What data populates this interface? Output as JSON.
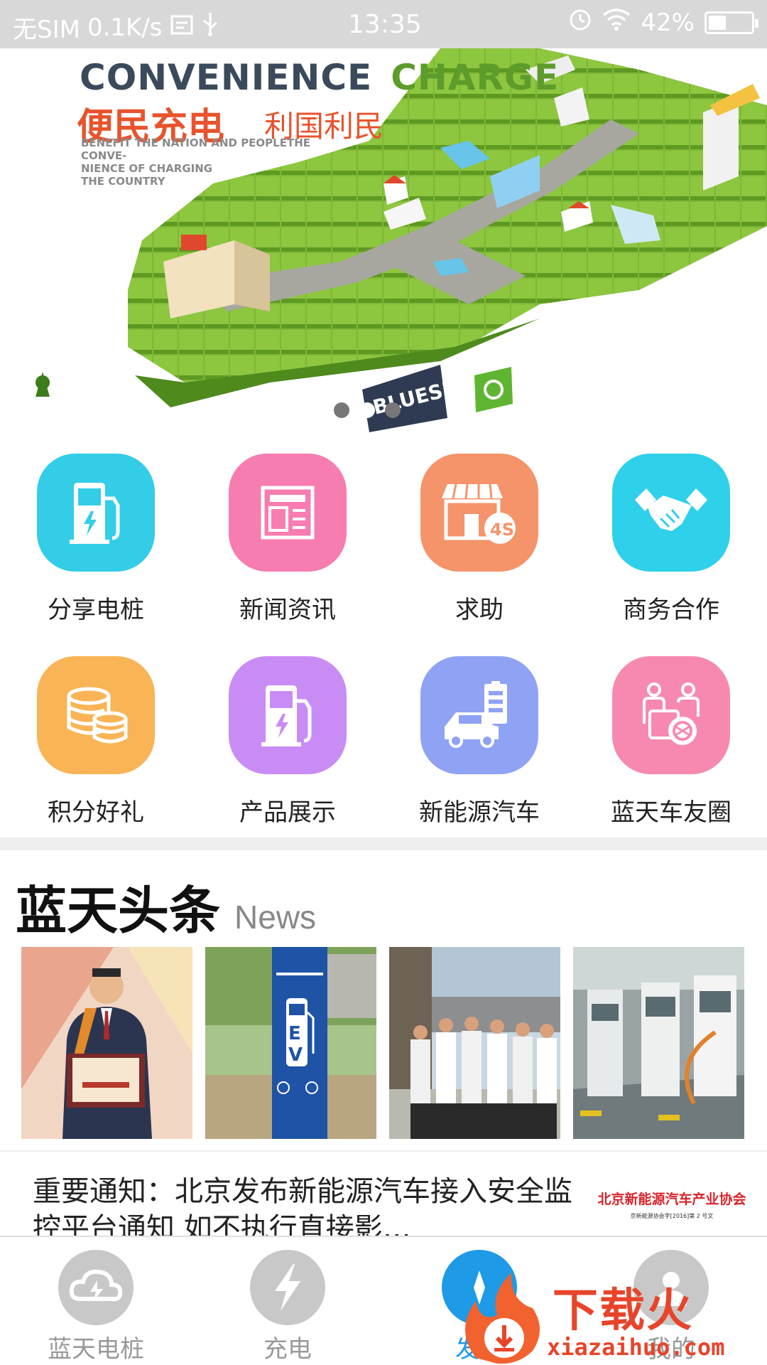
{
  "status_bar": {
    "carrier": "无SIM",
    "speed": "0.1K/s",
    "time": "13:35",
    "battery": "42%",
    "battery_level": 0.42
  },
  "banner": {
    "title_a": "CONVENIENCE",
    "title_b": "CHARGE",
    "cn_main": "便民充电",
    "cn_sub": "利国利民",
    "en_text": "BENEFIT THE NATION AND PEOPLETHE CONVE-\nNIENCE OF CHARGING\nTHE COUNTRY",
    "sign_text": "BLUESKY",
    "pages": 3,
    "active_page": 1
  },
  "grid": [
    {
      "label": "分享电桩",
      "color": "#33cde8",
      "icon": "charging-pile-icon"
    },
    {
      "label": "新闻资讯",
      "color": "#f77cb0",
      "icon": "newspaper-icon"
    },
    {
      "label": "求助",
      "color": "#f5936a",
      "icon": "4s-store-icon"
    },
    {
      "label": "商务合作",
      "color": "#2ed0ea",
      "icon": "handshake-icon"
    },
    {
      "label": "积分好礼",
      "color": "#f9b456",
      "icon": "coins-icon"
    },
    {
      "label": "产品展示",
      "color": "#c98cf4",
      "icon": "charging-pile-icon"
    },
    {
      "label": "新能源汽车",
      "color": "#8fa2f4",
      "icon": "electric-car-icon"
    },
    {
      "label": "蓝天车友圈",
      "color": "#f789b0",
      "icon": "community-icon"
    }
  ],
  "news": {
    "title": "蓝天头条",
    "subtitle": "News",
    "article_title": "重要通知：北京发布新能源汽车接入安全监控平台通知 如不执行直接影…",
    "article_image_title": "北京新能源汽车产业协会",
    "article_image_sub": "京新能源协会字[2016]第 2 号文"
  },
  "bottom_nav": [
    {
      "label": "蓝天电桩",
      "icon": "cloud-icon"
    },
    {
      "label": "充电",
      "icon": "lightning-icon"
    },
    {
      "label": "发现",
      "icon": "discover-icon"
    },
    {
      "label": "我的",
      "icon": "user-icon"
    }
  ],
  "watermark": {
    "text": "下载火",
    "url": "xiazaihuo.com"
  }
}
